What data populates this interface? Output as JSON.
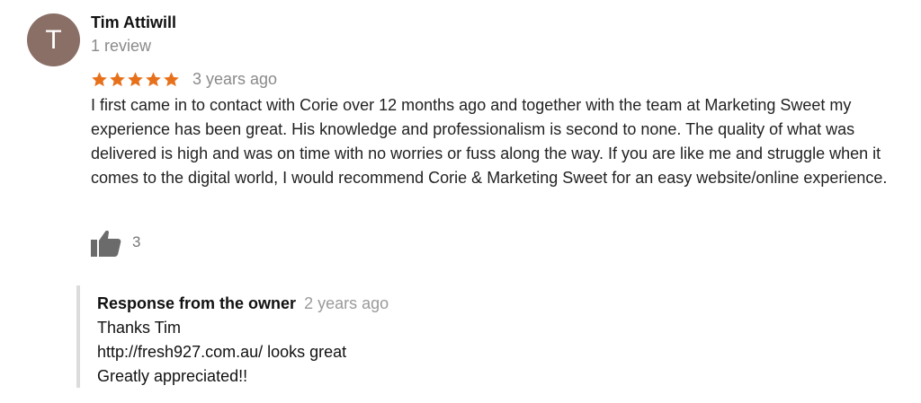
{
  "reviewer": {
    "initial": "T",
    "name": "Tim Attiwill",
    "review_count": "1 review",
    "avatar_color": "#8a6f66"
  },
  "review": {
    "rating": 5,
    "max_rating": 5,
    "star_color": "#e7711b",
    "date": "3 years ago",
    "text": "I first came in to contact with Corie over 12 months ago and together with the team at Marketing Sweet my experience has been great. His knowledge and professionalism is second to none. The quality of what was delivered is high and was on time with no worries or fuss along the way. If you are like me and struggle when it comes to the digital world, I would recommend Corie & Marketing Sweet for an easy website/online experience."
  },
  "like": {
    "icon": "thumbs-up-icon",
    "count": "3"
  },
  "owner_response": {
    "label": "Response from the owner",
    "date": "2 years ago",
    "lines": [
      "Thanks Tim",
      "http://fresh927.com.au/ looks great",
      "Greatly appreciated!!"
    ]
  }
}
